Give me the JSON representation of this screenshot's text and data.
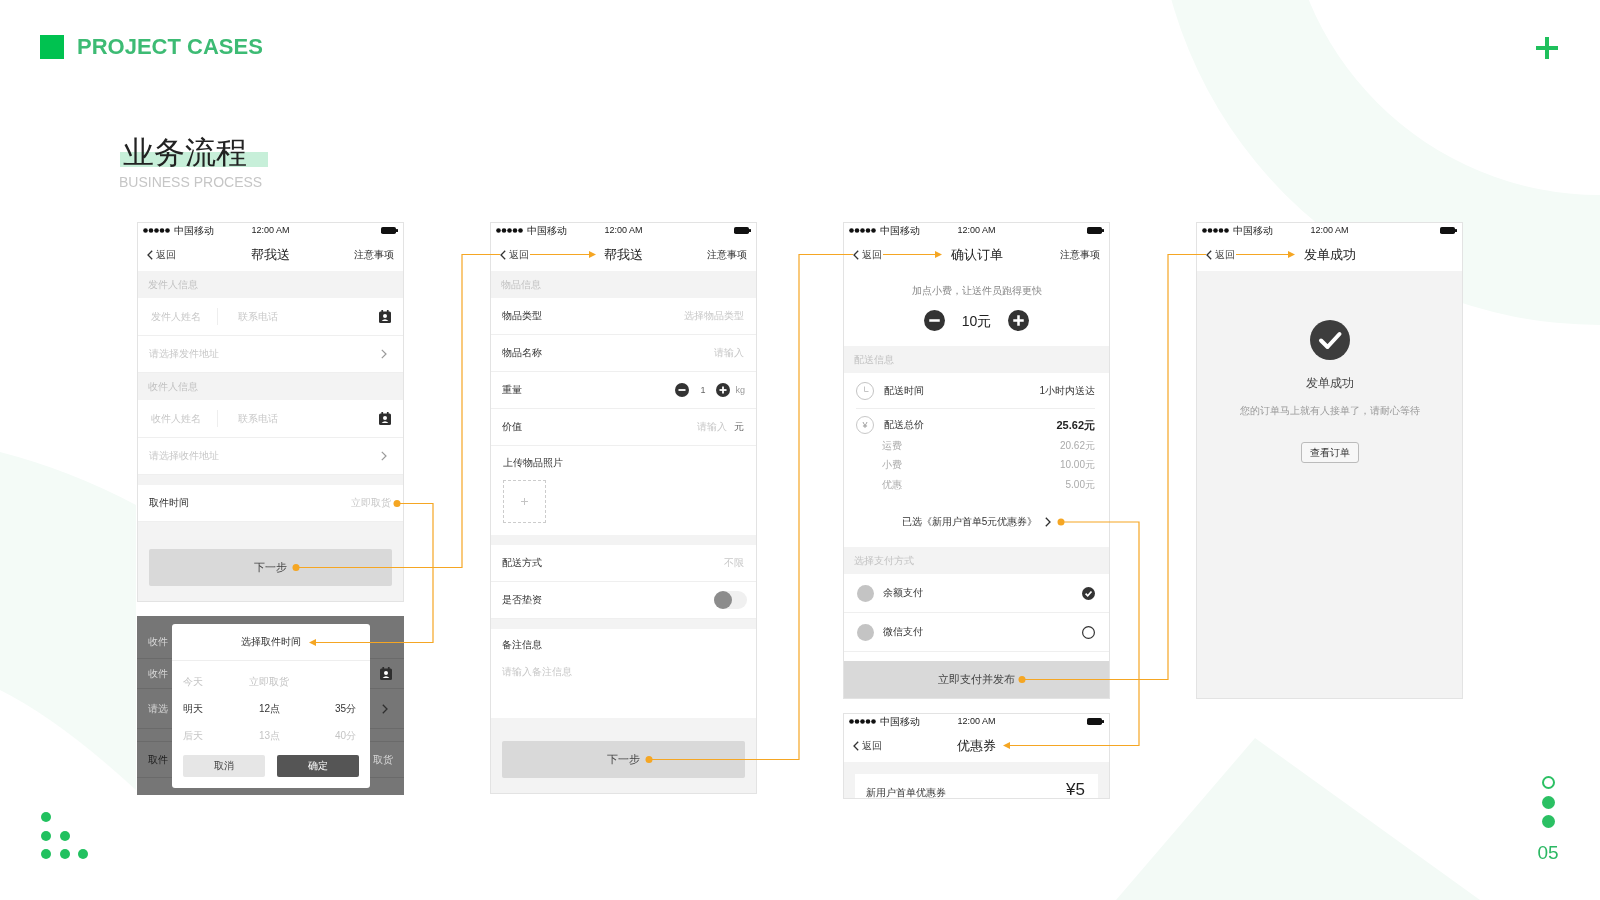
{
  "header": {
    "title": "PROJECT CASES"
  },
  "section": {
    "title": "业务流程",
    "subtitle": "BUSINESS PROCESS"
  },
  "steps": [
    {
      "screens": [
        {
          "kind": "form",
          "status_bar": {
            "carrier": "中国移动",
            "time": "12:00 AM"
          },
          "nav": {
            "back": "返回",
            "title": "帮我送",
            "action": "注意事项"
          },
          "rows": [
            {
              "kind": "section",
              "label": "发件人信息"
            },
            {
              "kind": "contact",
              "name_placeholder": "发件人姓名",
              "phone_placeholder": "联系电话"
            },
            {
              "kind": "picker",
              "placeholder": "请选择发件地址"
            },
            {
              "kind": "section",
              "label": "收件人信息"
            },
            {
              "kind": "contact",
              "name_placeholder": "收件人姓名",
              "phone_placeholder": "联系电话"
            },
            {
              "kind": "picker",
              "placeholder": "请选择收件地址"
            },
            {
              "kind": "gap"
            },
            {
              "kind": "field",
              "label": "取件时间",
              "placeholder": "立即取货"
            }
          ],
          "footer": {
            "kind": "button",
            "label": "下一步"
          }
        },
        {
          "kind": "dialog",
          "backdrop": [
            {
              "kind": "section",
              "label": "收件"
            },
            {
              "kind": "contact",
              "label": "收件"
            },
            {
              "kind": "picker",
              "label": "请选"
            },
            {
              "kind": "gap"
            },
            {
              "kind": "field",
              "label": "取件",
              "placeholder": "取货"
            }
          ],
          "dialog": {
            "title": "选择取件时间",
            "options": [
              {
                "cells": [
                  "今天",
                  "立即取货"
                ],
                "selected": false
              },
              {
                "cells": [
                  "明天",
                  "12点",
                  "35分"
                ],
                "selected": true
              },
              {
                "cells": [
                  "后天",
                  "13点",
                  "40分"
                ],
                "selected": false
              }
            ],
            "buttons": [
              {
                "kind": "secondary",
                "label": "取消"
              },
              {
                "kind": "primary",
                "label": "确定"
              }
            ]
          }
        }
      ]
    },
    {
      "screens": [
        {
          "kind": "form",
          "status_bar": {
            "carrier": "中国移动",
            "time": "12:00 AM"
          },
          "nav": {
            "back": "返回",
            "title": "帮我送",
            "action": "注意事项"
          },
          "rows": [
            {
              "kind": "section",
              "label": "物品信息"
            },
            {
              "kind": "field",
              "label": "物品类型",
              "placeholder": "选择物品类型"
            },
            {
              "kind": "field",
              "label": "物品名称",
              "placeholder": "请输入"
            },
            {
              "kind": "stepper",
              "label": "重量",
              "value": "1",
              "unit": "kg"
            },
            {
              "kind": "field",
              "label": "价值",
              "placeholder": "请输入",
              "unit": "元"
            },
            {
              "kind": "upload",
              "label": "上传物品照片"
            },
            {
              "kind": "gap"
            },
            {
              "kind": "field",
              "label": "配送方式",
              "placeholder": "不限"
            },
            {
              "kind": "toggle",
              "label": "是否垫资",
              "on": false
            },
            {
              "kind": "gap"
            },
            {
              "kind": "textarea",
              "label": "备注信息",
              "placeholder": "请输入备注信息"
            }
          ],
          "footer": {
            "kind": "button",
            "label": "下一步"
          }
        }
      ]
    },
    {
      "screens": [
        {
          "kind": "form",
          "status_bar": {
            "carrier": "中国移动",
            "time": "12:00 AM"
          },
          "nav": {
            "back": "返回",
            "title": "确认订单",
            "action": "注意事项"
          },
          "rows": [
            {
              "kind": "tip",
              "hint": "加点小费，让送件员跑得更快",
              "value": "10元"
            },
            {
              "kind": "section",
              "label": "配送信息"
            },
            {
              "kind": "time",
              "label": "配送时间",
              "value": "1小时内送达"
            },
            {
              "kind": "price",
              "symbol": "¥",
              "label": "配送总价",
              "value": "25.62元",
              "items": [
                {
                  "label": "运费",
                  "value": "20.62元"
                },
                {
                  "label": "小费",
                  "value": "10.00元"
                },
                {
                  "label": "优惠",
                  "value": "5.00元"
                }
              ]
            },
            {
              "kind": "coupon",
              "text": "已选《新用户首单5元优惠券》"
            },
            {
              "kind": "section",
              "label": "选择支付方式"
            },
            {
              "kind": "payment",
              "label": "余额支付",
              "selected": true
            },
            {
              "kind": "payment",
              "label": "微信支付",
              "selected": false
            }
          ],
          "footer": {
            "kind": "bar",
            "label": "立即支付并发布"
          }
        },
        {
          "kind": "coupons",
          "status_bar": {
            "carrier": "中国移动",
            "time": "12:00 AM"
          },
          "nav": {
            "back": "返回",
            "title": "优惠券"
          },
          "coupons": [
            {
              "name": "新用户首单优惠券",
              "amount": "¥5"
            }
          ]
        }
      ]
    },
    {
      "screens": [
        {
          "kind": "result",
          "status_bar": {
            "carrier": "中国移动",
            "time": "12:00 AM"
          },
          "nav": {
            "back": "返回",
            "title": "发单成功"
          },
          "result": {
            "title": "发单成功",
            "message": "您的订单马上就有人接单了，请耐心等待",
            "button": "查看订单"
          }
        }
      ]
    }
  ],
  "pager": [
    {
      "filled": false
    },
    {
      "filled": true
    },
    {
      "filled": true
    }
  ],
  "page_number": "05"
}
